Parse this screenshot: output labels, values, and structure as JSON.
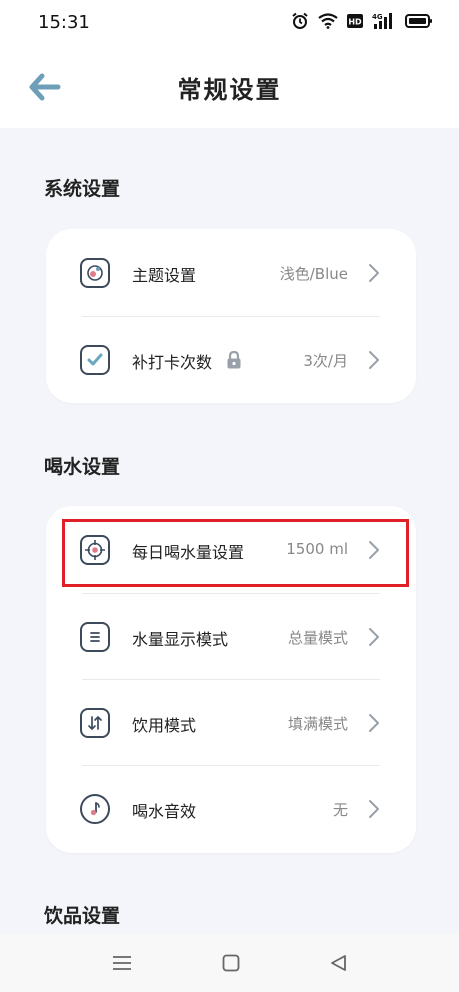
{
  "status": {
    "time": "15:31"
  },
  "header": {
    "title": "常规设置"
  },
  "sections": {
    "system": {
      "title": "系统设置",
      "items": [
        {
          "label": "主题设置",
          "value": "浅色/Blue"
        },
        {
          "label": "补打卡次数",
          "value": "3次/月"
        }
      ]
    },
    "drinking": {
      "title": "喝水设置",
      "items": [
        {
          "label": "每日喝水量设置",
          "value": "1500 ml"
        },
        {
          "label": "水量显示模式",
          "value": "总量模式"
        },
        {
          "label": "饮用模式",
          "value": "填满模式"
        },
        {
          "label": "喝水音效",
          "value": "无"
        }
      ]
    },
    "beverage": {
      "title": "饮品设置"
    }
  },
  "colors": {
    "accent": "#6e9fb8",
    "highlight": "#e01f26",
    "icon_stroke": "#3d4a5c"
  }
}
